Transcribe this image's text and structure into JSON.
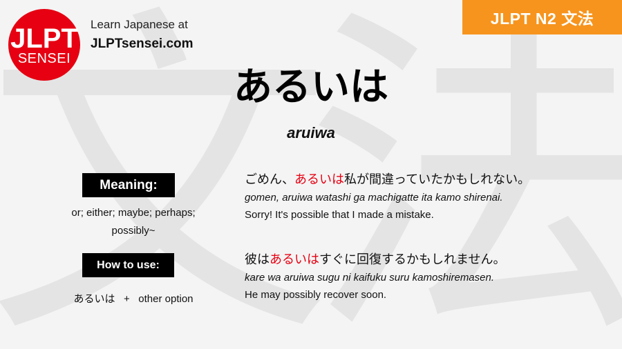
{
  "watermark": {
    "chars": [
      "文",
      "法"
    ]
  },
  "logo": {
    "main": "JLPT",
    "sub": "SENSEI"
  },
  "header": {
    "tagline": "Learn Japanese at",
    "site": "JLPTsensei.com"
  },
  "badge": {
    "label": "JLPT N2 文法",
    "color": "#f7941d"
  },
  "grammar": {
    "title": "あるいは",
    "romaji": "aruiwa"
  },
  "meaning": {
    "label": "Meaning:",
    "text": "or; either; maybe; perhaps; possibly~"
  },
  "how_to_use": {
    "label": "How to use:",
    "pattern_jp": "あるいは",
    "plus": "+",
    "pattern_en": "other option"
  },
  "examples": [
    {
      "jp_before": "ごめん、",
      "jp_highlight": "あるいは",
      "jp_after": "私が間違っていたかもしれない。",
      "romaji": "gomen, aruiwa watashi ga machigatte ita kamo shirenai.",
      "english": "Sorry! It's possible that I made a mistake."
    },
    {
      "jp_before": "彼は",
      "jp_highlight": "あるいは",
      "jp_after": "すぐに回復するかもしれません。",
      "romaji": "kare wa aruiwa sugu ni kaifuku suru kamoshiremasen.",
      "english": "He may possibly recover soon."
    }
  ],
  "colors": {
    "highlight": "#e60012",
    "logo": "#e60012",
    "background": "#f4f4f4"
  }
}
